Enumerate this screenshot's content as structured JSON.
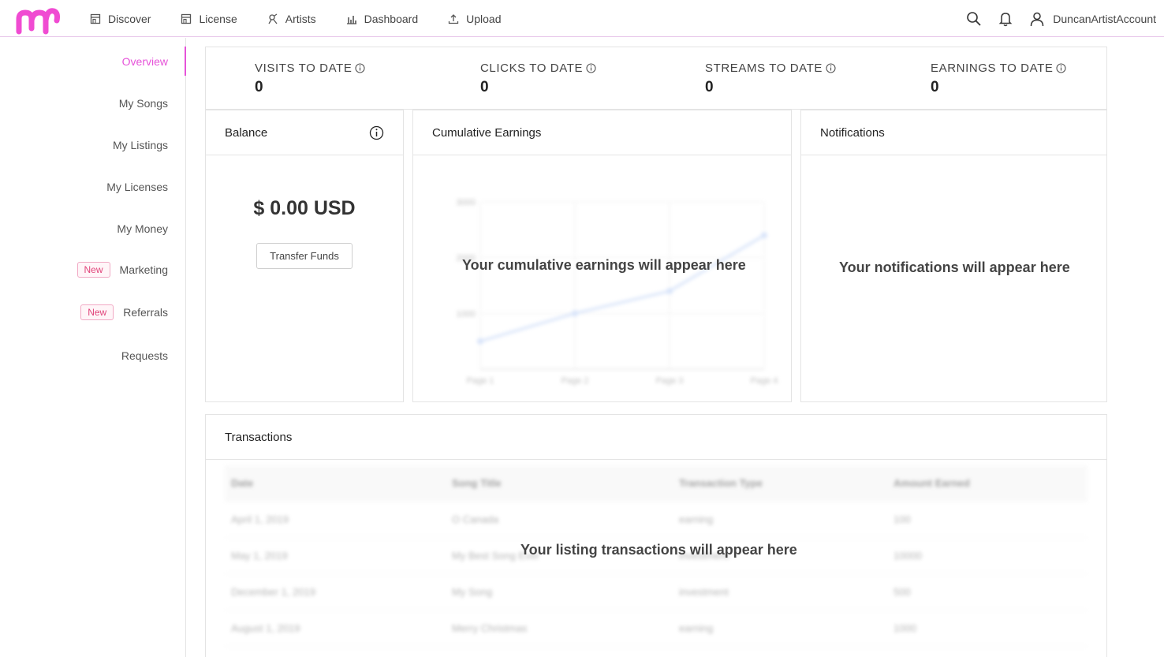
{
  "nav": {
    "items": [
      {
        "label": "Discover",
        "icon": "storefront-icon"
      },
      {
        "label": "License",
        "icon": "storefront-icon"
      },
      {
        "label": "Artists",
        "icon": "artist-icon"
      },
      {
        "label": "Dashboard",
        "icon": "bar-chart-icon"
      },
      {
        "label": "Upload",
        "icon": "upload-icon"
      }
    ],
    "user_name": "DuncanArtistAccount"
  },
  "sidebar": {
    "items": [
      {
        "label": "Overview",
        "active": true
      },
      {
        "label": "My Songs"
      },
      {
        "label": "My Listings"
      },
      {
        "label": "My Licenses"
      },
      {
        "label": "My Money"
      },
      {
        "label": "Marketing",
        "badge": "New"
      },
      {
        "label": "Referrals",
        "badge": "New"
      },
      {
        "label": "Requests"
      }
    ]
  },
  "stats": [
    {
      "label": "VISITS TO DATE",
      "value": "0"
    },
    {
      "label": "CLICKS TO DATE",
      "value": "0"
    },
    {
      "label": "STREAMS TO DATE",
      "value": "0"
    },
    {
      "label": "EARNINGS TO DATE",
      "value": "0"
    }
  ],
  "balance": {
    "title": "Balance",
    "amount": "$ 0.00 USD",
    "button": "Transfer Funds"
  },
  "earnings": {
    "title": "Cumulative Earnings",
    "placeholder": "Your cumulative earnings will appear here",
    "chart_data": {
      "type": "line",
      "categories": [
        "Page 1",
        "Page 2",
        "Page 3",
        "Page 4"
      ],
      "values": [
        500,
        1000,
        1400,
        2400
      ],
      "ylim": [
        0,
        3000
      ],
      "yticks": [
        1000,
        2000,
        3000
      ]
    }
  },
  "notifications": {
    "title": "Notifications",
    "placeholder": "Your notifications will appear here"
  },
  "transactions": {
    "title": "Transactions",
    "placeholder": "Your listing transactions will appear here",
    "columns": [
      "Date",
      "Song Title",
      "Transaction Type",
      "Amount Earned"
    ],
    "rows": [
      [
        "April 1, 2019",
        "O Canada",
        "earning",
        "100"
      ],
      [
        "May 1, 2019",
        "My Best Song Ever",
        "investment",
        "10000"
      ],
      [
        "December 1, 2019",
        "My Song",
        "investment",
        "500"
      ],
      [
        "August 1, 2019",
        "Merry Christmas",
        "earning",
        "1000"
      ]
    ]
  },
  "colors": {
    "accent": "#e653d9",
    "chart_line": "#b7cdf5"
  }
}
